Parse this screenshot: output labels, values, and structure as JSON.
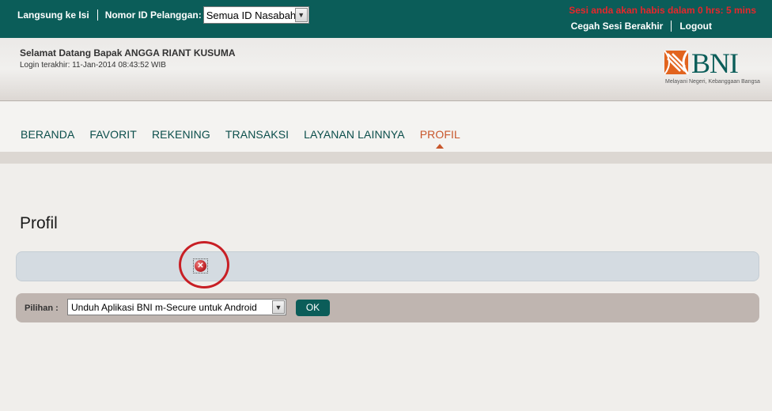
{
  "topbar": {
    "quick_fill_label": "Langsung ke Isi",
    "customer_id_label": "Nomor ID Pelanggan:",
    "customer_id_value": "Semua ID Nasabah",
    "session_warning": "Sesi anda akan habis dalam 0 hrs: 5 mins",
    "prevent_session_end": "Cegah Sesi Berakhir",
    "logout": "Logout"
  },
  "header": {
    "welcome": "Selamat Datang Bapak  ANGGA  RIANT  KUSUMA",
    "last_login": "Login terakhir:   11-Jan-2014 08:43:52  WIB",
    "logo_text": "BNI",
    "logo_tagline": "Melayani Negeri, Kebanggaan Bangsa"
  },
  "nav": {
    "items": [
      {
        "label": "BERANDA"
      },
      {
        "label": "FAVORIT"
      },
      {
        "label": "REKENING"
      },
      {
        "label": "TRANSAKSI"
      },
      {
        "label": "LAYANAN LAINNYA"
      },
      {
        "label": "PROFIL"
      }
    ],
    "active_index": 5
  },
  "content": {
    "title": "Profil",
    "option_label": "Pilihan :",
    "option_value": "Unduh Aplikasi BNI m-Secure untuk Android",
    "ok_button": "OK"
  },
  "icons": {
    "error": "error-icon",
    "dropdown": "chevron-down-icon"
  },
  "colors": {
    "brand": "#0b5d59",
    "warning": "#e8262b",
    "active_nav": "#c8562b"
  }
}
